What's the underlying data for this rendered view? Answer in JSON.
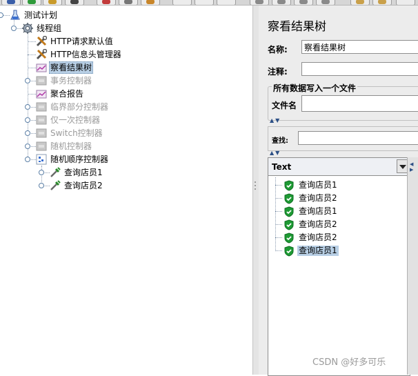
{
  "tree": {
    "items": [
      {
        "label": "测试计划",
        "icon": "test-plan-icon",
        "state": "normal"
      },
      {
        "label": "线程组",
        "icon": "thread-group-gear-icon",
        "state": "normal"
      },
      {
        "label": "HTTP请求默认值",
        "icon": "config-tools-icon",
        "state": "normal"
      },
      {
        "label": "HTTP信息头管理器",
        "icon": "config-tools-icon",
        "state": "normal"
      },
      {
        "label": "察看结果树",
        "icon": "listener-chart-icon",
        "state": "selected"
      },
      {
        "label": "事务控制器",
        "icon": "controller-icon",
        "state": "disabled"
      },
      {
        "label": "聚合报告",
        "icon": "listener-chart-icon",
        "state": "normal"
      },
      {
        "label": "临界部分控制器",
        "icon": "controller-icon",
        "state": "disabled"
      },
      {
        "label": "仅一次控制器",
        "icon": "controller-icon",
        "state": "disabled"
      },
      {
        "label": "Switch控制器",
        "icon": "controller-icon",
        "state": "disabled"
      },
      {
        "label": "随机控制器",
        "icon": "controller-icon",
        "state": "disabled"
      },
      {
        "label": "随机顺序控制器",
        "icon": "random-order-controller-icon",
        "state": "normal"
      },
      {
        "label": "查询店员1",
        "icon": "sampler-pipette-icon",
        "state": "normal"
      },
      {
        "label": "查询店员2",
        "icon": "sampler-pipette-icon",
        "state": "normal"
      }
    ]
  },
  "panel": {
    "title": "察看结果树",
    "name_label": "名称:",
    "name_value": "察看结果树",
    "comment_label": "注释:",
    "comment_value": "",
    "write_group_title": "所有数据写入一个文件",
    "filename_label": "文件名",
    "filename_value": "",
    "search_label": "查找:",
    "search_value": ""
  },
  "results": {
    "renderer_selected": "Text",
    "samples": [
      {
        "label": "查询店员1",
        "status": "success"
      },
      {
        "label": "查询店员2",
        "status": "success"
      },
      {
        "label": "查询店员1",
        "status": "success"
      },
      {
        "label": "查询店员2",
        "status": "success"
      },
      {
        "label": "查询店员2",
        "status": "success"
      },
      {
        "label": "查询店员1",
        "status": "success",
        "selected": true
      }
    ]
  },
  "watermark": "CSDN @好多可乐",
  "colors": {
    "selection": "#b8cfe5",
    "success_green": "#1e9a34",
    "disabled_text": "#9a9a9a",
    "panel_bg": "#ececec"
  }
}
